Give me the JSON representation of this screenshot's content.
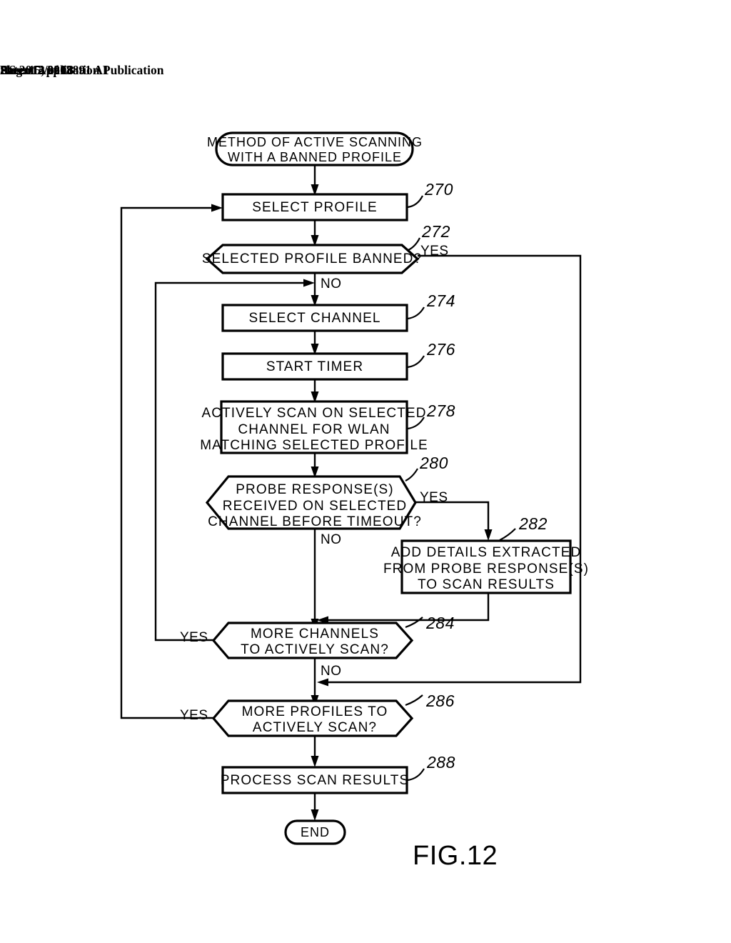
{
  "header": {
    "publication": "Patent Application Publication",
    "date": "Aug. 15, 2013",
    "sheet": "Sheet 12 of 13",
    "patent_number": "US 2013/0208891 A1"
  },
  "figure": {
    "label": "FIG.12",
    "title": "METHOD OF ACTIVE SCANNING WITH A BANNED PROFILE"
  },
  "flowchart": {
    "start": {
      "line1": "METHOD OF ACTIVE SCANNING",
      "line2": "WITH A BANNED PROFILE"
    },
    "end": {
      "label": "END"
    },
    "nodes": [
      {
        "ref": "270",
        "type": "process",
        "lines": [
          "SELECT PROFILE"
        ]
      },
      {
        "ref": "272",
        "type": "decision",
        "lines": [
          "SELECTED PROFILE BANNED?"
        ],
        "yes_label": "YES",
        "no_label": "NO"
      },
      {
        "ref": "274",
        "type": "process",
        "lines": [
          "SELECT CHANNEL"
        ]
      },
      {
        "ref": "276",
        "type": "process",
        "lines": [
          "START TIMER"
        ]
      },
      {
        "ref": "278",
        "type": "process",
        "lines": [
          "ACTIVELY SCAN ON SELECTED",
          "CHANNEL FOR WLAN",
          "MATCHING SELECTED PROFILE"
        ]
      },
      {
        "ref": "280",
        "type": "decision",
        "lines": [
          "PROBE RESPONSE(S)",
          "RECEIVED ON SELECTED",
          "CHANNEL BEFORE TIMEOUT?"
        ],
        "yes_label": "YES",
        "no_label": "NO"
      },
      {
        "ref": "282",
        "type": "process",
        "lines": [
          "ADD DETAILS EXTRACTED",
          "FROM PROBE RESPONSE(S)",
          "TO SCAN RESULTS"
        ]
      },
      {
        "ref": "284",
        "type": "decision",
        "lines": [
          "MORE CHANNELS",
          "TO ACTIVELY SCAN?"
        ],
        "yes_label": "YES",
        "no_label": "NO"
      },
      {
        "ref": "286",
        "type": "decision",
        "lines": [
          "MORE PROFILES TO",
          "ACTIVELY SCAN?"
        ],
        "yes_label": "YES",
        "no_label": ""
      },
      {
        "ref": "288",
        "type": "process",
        "lines": [
          "PROCESS SCAN RESULTS"
        ]
      }
    ]
  },
  "colors": {
    "ink": "#000000",
    "paper": "#ffffff"
  }
}
